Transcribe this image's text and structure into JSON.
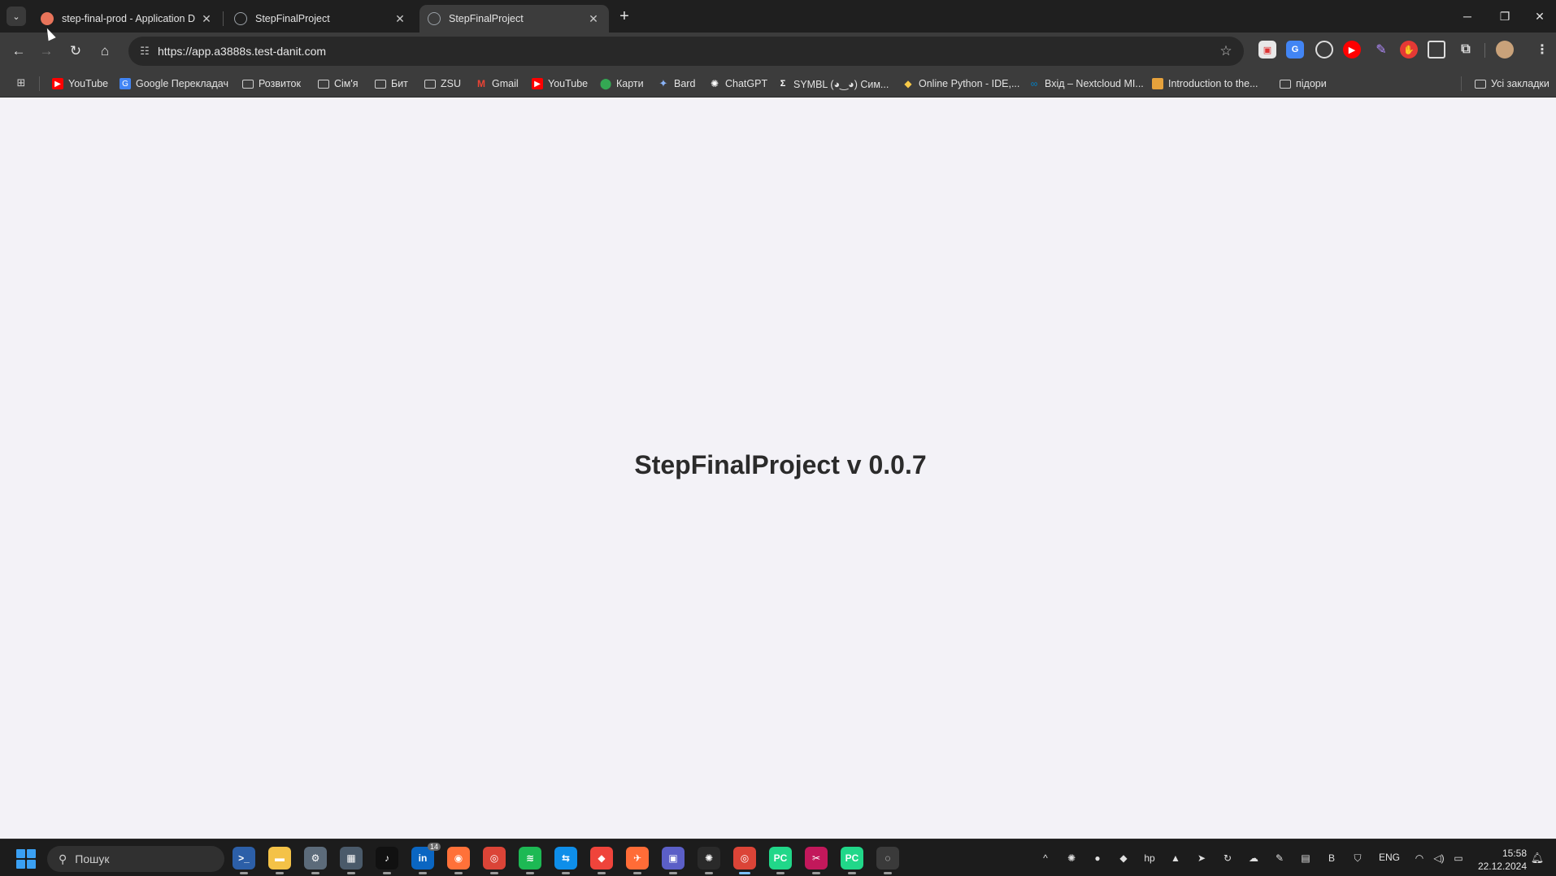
{
  "browser": {
    "tabs": [
      {
        "title": "step-final-prod - Application D",
        "favicon": "argo-favicon",
        "favicon_color": "#e8745a",
        "active": false
      },
      {
        "title": "StepFinalProject",
        "favicon": "globe-favicon",
        "favicon_color": "#9aa0a6",
        "active": false
      },
      {
        "title": "StepFinalProject",
        "favicon": "globe-favicon",
        "favicon_color": "#9aa0a6",
        "active": true
      }
    ],
    "new_tab_symbol": "+",
    "url": "https://app.a3888s.test-danit.com",
    "bookmarks": [
      {
        "label": "YouTube",
        "icon": "youtube-icon",
        "color": "#ff0000"
      },
      {
        "label": "Google Перекладач",
        "icon": "translate-icon",
        "color": "#4285f4"
      },
      {
        "label": "Розвиток",
        "icon": "folder-icon",
        "color": "#cfcfcf"
      },
      {
        "label": "Сім'я",
        "icon": "folder-icon",
        "color": "#cfcfcf"
      },
      {
        "label": "Бит",
        "icon": "folder-icon",
        "color": "#cfcfcf"
      },
      {
        "label": "ZSU",
        "icon": "folder-icon",
        "color": "#cfcfcf"
      },
      {
        "label": "Gmail",
        "icon": "gmail-icon",
        "color": "#ea4335"
      },
      {
        "label": "YouTube",
        "icon": "youtube-icon",
        "color": "#ff0000"
      },
      {
        "label": "Карти",
        "icon": "maps-icon",
        "color": "#34a853"
      },
      {
        "label": "Bard",
        "icon": "bard-icon",
        "color": "#8ab4f8"
      },
      {
        "label": "ChatGPT",
        "icon": "chatgpt-icon",
        "color": "#ffffff"
      },
      {
        "label": "SYMBL (◕‿◕) Сим...",
        "icon": "symbl-icon",
        "color": "#ffffff"
      },
      {
        "label": "Online Python - IDE,...",
        "icon": "python-icon",
        "color": "#f7c948"
      },
      {
        "label": "Вхід – Nextcloud MI...",
        "icon": "nextcloud-icon",
        "color": "#0082c9"
      },
      {
        "label": "Introduction to the...",
        "icon": "package-icon",
        "color": "#e6a23c"
      },
      {
        "label": "підори",
        "icon": "folder-icon",
        "color": "#cfcfcf"
      }
    ],
    "all_bookmarks_label": "Усі закладки"
  },
  "page": {
    "heading": "StepFinalProject v 0.0.7"
  },
  "taskbar": {
    "search_placeholder": "Пошук",
    "apps": [
      {
        "name": "terminal-icon",
        "color": "#2c5fa8",
        "glyph": ">_"
      },
      {
        "name": "file-explorer-icon",
        "color": "#f4c247",
        "glyph": "▬"
      },
      {
        "name": "settings-icon",
        "color": "#5c6b7a",
        "glyph": "⚙"
      },
      {
        "name": "calculator-icon",
        "color": "#4a5a6a",
        "glyph": "▦"
      },
      {
        "name": "tiktok-icon",
        "color": "#111111",
        "glyph": "♪"
      },
      {
        "name": "linkedin-icon",
        "color": "#0a66c2",
        "glyph": "in",
        "badge": "14"
      },
      {
        "name": "firefox-icon",
        "color": "#ff7139",
        "glyph": "◉"
      },
      {
        "name": "chrome-icon",
        "color": "#db4437",
        "glyph": "◎"
      },
      {
        "name": "spotify-icon",
        "color": "#1db954",
        "glyph": "≋"
      },
      {
        "name": "teamviewer-icon",
        "color": "#0e8ee9",
        "glyph": "⇆"
      },
      {
        "name": "anydesk-icon",
        "color": "#ef443b",
        "glyph": "◆"
      },
      {
        "name": "postman-icon",
        "color": "#ff6c37",
        "glyph": "✈"
      },
      {
        "name": "team-app-icon",
        "color": "#5b5fc7",
        "glyph": "▣"
      },
      {
        "name": "chatgpt-app-icon",
        "color": "#2a2a2a",
        "glyph": "✺"
      },
      {
        "name": "chrome-profile-icon",
        "color": "#db4437",
        "glyph": "◎"
      },
      {
        "name": "pycharm-icon",
        "color": "#21d789",
        "glyph": "PC"
      },
      {
        "name": "snipping-tool-icon",
        "color": "#c2185b",
        "glyph": "✂"
      },
      {
        "name": "pycharm-2-icon",
        "color": "#21d789",
        "glyph": "PC"
      },
      {
        "name": "recorder-icon",
        "color": "#3a3a3a",
        "glyph": "◌"
      }
    ],
    "tray": [
      {
        "name": "show-hidden-icons-icon",
        "glyph": "^"
      },
      {
        "name": "chatgpt-tray-icon",
        "glyph": "✺"
      },
      {
        "name": "spotify-tray-icon",
        "glyph": "●"
      },
      {
        "name": "app-tray-icon",
        "glyph": "◆"
      },
      {
        "name": "hp-tray-icon",
        "glyph": "hp"
      },
      {
        "name": "drive-tray-icon",
        "glyph": "▲"
      },
      {
        "name": "telegram-tray-icon",
        "glyph": "➤"
      },
      {
        "name": "sync-tray-icon",
        "glyph": "↻"
      },
      {
        "name": "onedrive-tray-icon",
        "glyph": "☁"
      },
      {
        "name": "pen-tray-icon",
        "glyph": "✎"
      },
      {
        "name": "keyboard-tray-icon",
        "glyph": "▤"
      },
      {
        "name": "b-tray-icon",
        "glyph": "B"
      },
      {
        "name": "defender-tray-icon",
        "glyph": "⛉"
      }
    ],
    "language": "ENG",
    "time": "15:58",
    "date": "22.12.2024"
  }
}
